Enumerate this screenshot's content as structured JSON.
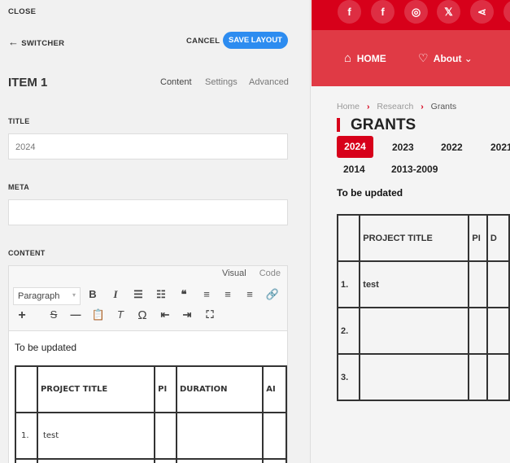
{
  "panel": {
    "close": "CLOSE",
    "switcher": "SWITCHER",
    "cancel": "CANCEL",
    "save": "SAVE LAYOUT",
    "item_title": "ITEM 1",
    "tabs": [
      "Content",
      "Settings",
      "Advanced"
    ],
    "title_label": "TITLE",
    "title_value": "2024",
    "meta_label": "META",
    "meta_value": "",
    "content_label": "CONTENT",
    "editor": {
      "modes": [
        "Visual",
        "Code"
      ],
      "format": "Paragraph",
      "text": "To be updated",
      "table": {
        "headers": [
          "",
          "PROJECT TITLE",
          "PI",
          "DURATION",
          "AI"
        ],
        "rows": [
          [
            "1.",
            "test",
            "",
            "",
            ""
          ]
        ]
      }
    }
  },
  "site": {
    "colors": {
      "topbar": "#d7001a",
      "nav": "#e03a45",
      "accent": "#d7001a"
    },
    "social": [
      "f",
      "f",
      "◎",
      "𝕏",
      "⋖",
      "○"
    ],
    "nav": [
      {
        "icon": "home-icon",
        "label": "HOME"
      },
      {
        "icon": "heart-icon",
        "label": "About"
      }
    ],
    "breadcrumb": [
      "Home",
      "Research",
      "Grants"
    ],
    "title": "GRANTS",
    "years": [
      "2024",
      "2023",
      "2022",
      "2021",
      "2014",
      "2013-2009"
    ],
    "active_year": "2024",
    "text": "To be updated",
    "table": {
      "headers": [
        "",
        "PROJECT TITLE",
        "PI",
        "D"
      ],
      "rows": [
        [
          "1.",
          "test",
          "",
          ""
        ],
        [
          "2.",
          "",
          "",
          ""
        ],
        [
          "3.",
          "",
          "",
          ""
        ]
      ]
    }
  }
}
